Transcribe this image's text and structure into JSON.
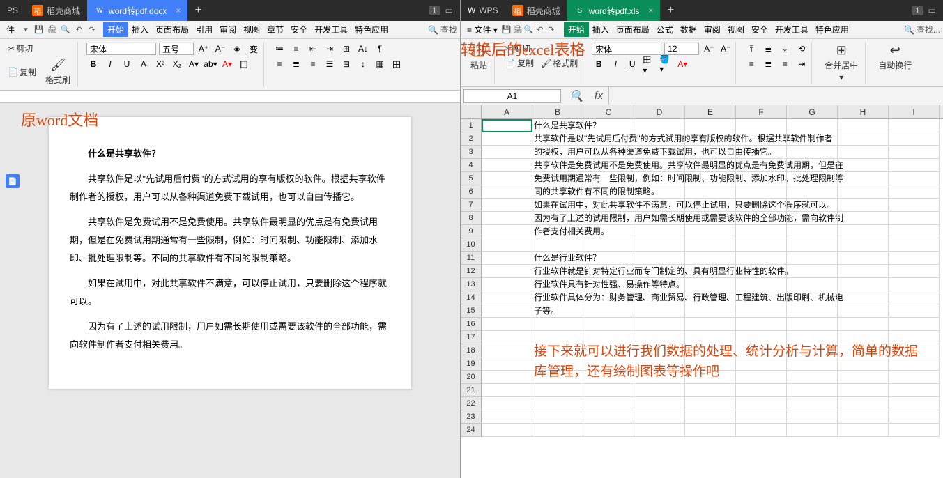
{
  "left": {
    "tabs": {
      "ps": "PS",
      "mall": "稻壳商城",
      "doc": "word转pdf.docx",
      "badge": "1"
    },
    "menu": [
      "件",
      "插入",
      "页面布局",
      "引用",
      "审阅",
      "视图",
      "章节",
      "安全",
      "开发工具",
      "特色应用"
    ],
    "menu_start": "开始",
    "search": "查找",
    "ribbon": {
      "cut": "剪切",
      "copy": "复制",
      "paste": "格式刷",
      "font": "宋体",
      "size": "五号"
    },
    "annotation": "原word文档",
    "doc": {
      "h1": "什么是共享软件？",
      "p1": "共享软件是以\"先试用后付费\"的方式试用的享有版权的软件。根据共享软件制作者的授权，用户可以从各种渠道免费下载试用，也可以自由传播它。",
      "p2": "共享软件是免费试用不是免费使用。共享软件最明显的优点是有免费试用期，但是在免费试用期通常有一些限制，例如：时间限制、功能限制、添加水印、批处理限制等。不同的共享软件有不同的限制策略。",
      "p3": "如果在试用中，对此共享软件不满意，可以停止试用，只要删除这个程序就可以。",
      "p4": "因为有了上述的试用限制，用户如需长期使用或需要该软件的全部功能，需向软件制作者支付相关费用。"
    }
  },
  "right": {
    "tabs": {
      "wps": "WPS",
      "mall": "稻壳商城",
      "xls": "word转pdf.xls",
      "badge": "1"
    },
    "filemenu": "文件",
    "menu": [
      "插入",
      "页面布局",
      "公式",
      "数据",
      "审阅",
      "视图",
      "安全",
      "开发工具",
      "特色应用"
    ],
    "menu_start": "开始",
    "search": "查找...",
    "ribbon": {
      "paste": "粘贴",
      "cut": "剪切",
      "copy": "复制",
      "brush": "格式刷",
      "font": "宋体",
      "size": "12",
      "merge": "合并居中",
      "wrap": "自动换行"
    },
    "annotation": "转换后的excel表格",
    "namebox": "A1",
    "cols": [
      "A",
      "B",
      "C",
      "D",
      "E",
      "F",
      "G",
      "H",
      "I"
    ],
    "cells": {
      "r1": "什么是共享软件？",
      "r2": "共享软件是以\"先试用后付费\"的方式试用的享有版权的软件。根据共享软件制作者",
      "r3": "的授权，用户可以从各种渠道免费下载试用，也可以自由传播它。",
      "r4": "共享软件是免费试用不是免费使用。共享软件最明显的优点是有免费试用期，但是在",
      "r5": "免费试用期通常有一些限制，例如：时间限制、功能限制、添加水印、批处理限制等",
      "r6": "同的共享软件有不同的限制策略。",
      "r7": "如果在试用中，对此共享软件不满意，可以停止试用，只要删除这个程序就可以。",
      "r8": "因为有了上述的试用限制，用户如需长期使用或需要该软件的全部功能，需向软件制",
      "r9": "作者支付相关费用。",
      "r11": "什么是行业软件？",
      "r12": "行业软件就是针对特定行业而专门制定的、具有明显行业特性的软件。",
      "r13": "行业软件具有针对性强、易操作等特点。",
      "r14": "行业软件具体分为：财务管理、商业贸易、行政管理、工程建筑、出版印刷、机械电",
      "r15": "子等。"
    },
    "note": "接下来就可以进行我们数据的处理、统计分析与计算，简单的数据库管理，还有绘制图表等操作吧"
  }
}
